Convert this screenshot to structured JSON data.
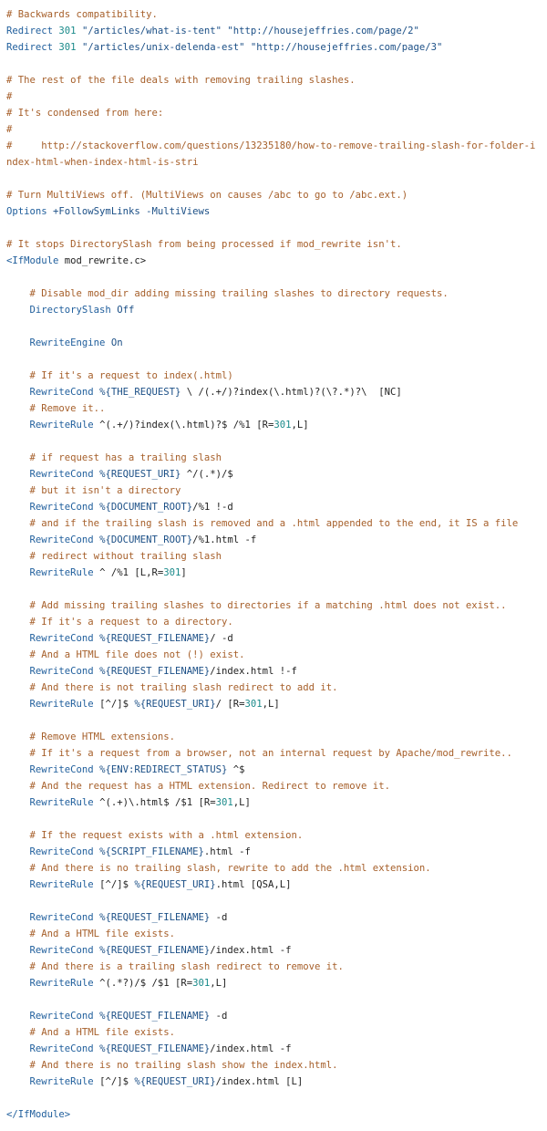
{
  "colors": {
    "comment": "#a65f2a",
    "directive": "#1f5e9c",
    "number": "#1a8a8a",
    "string": "#1b4f86",
    "plain": "#222222",
    "background": "#ffffff"
  },
  "lines": [
    {
      "type": "comment",
      "tokens": [
        {
          "t": "# Backwards compatibility.",
          "k": "comment"
        }
      ]
    },
    {
      "type": "code",
      "tokens": [
        {
          "t": "Redirect",
          "k": "directive"
        },
        {
          "t": " ",
          "k": "plain"
        },
        {
          "t": "301",
          "k": "num"
        },
        {
          "t": " \"/articles/what-is-tent\" \"http://housejeffries.com/page/2\"",
          "k": "str"
        }
      ]
    },
    {
      "type": "code",
      "tokens": [
        {
          "t": "Redirect",
          "k": "directive"
        },
        {
          "t": " ",
          "k": "plain"
        },
        {
          "t": "301",
          "k": "num"
        },
        {
          "t": " \"/articles/unix-delenda-est\" \"http://housejeffries.com/page/3\"",
          "k": "str"
        }
      ]
    },
    {
      "type": "blank",
      "tokens": []
    },
    {
      "type": "comment",
      "tokens": [
        {
          "t": "# The rest of the file deals with removing trailing slashes.",
          "k": "comment"
        }
      ]
    },
    {
      "type": "comment",
      "tokens": [
        {
          "t": "#",
          "k": "comment"
        }
      ]
    },
    {
      "type": "comment",
      "tokens": [
        {
          "t": "# It's condensed from here:",
          "k": "comment"
        }
      ]
    },
    {
      "type": "comment",
      "tokens": [
        {
          "t": "#",
          "k": "comment"
        }
      ]
    },
    {
      "type": "comment-wrap",
      "tokens": [
        {
          "t": "#     http://stackoverflow.com/questions/13235180/how-to-remove-trailing-slash-for-folder-index-html-when-index-html-is-stri",
          "k": "comment"
        }
      ]
    },
    {
      "type": "blank",
      "tokens": []
    },
    {
      "type": "comment",
      "tokens": [
        {
          "t": "# Turn MultiViews off. (MultiViews on causes /abc to go to /abc.ext.)",
          "k": "comment"
        }
      ]
    },
    {
      "type": "code",
      "tokens": [
        {
          "t": "Options",
          "k": "directive"
        },
        {
          "t": " +FollowSymLinks -MultiViews",
          "k": "str"
        }
      ]
    },
    {
      "type": "blank",
      "tokens": []
    },
    {
      "type": "comment",
      "tokens": [
        {
          "t": "# It stops DirectorySlash from being processed if mod_rewrite isn't.",
          "k": "comment"
        }
      ]
    },
    {
      "type": "code",
      "tokens": [
        {
          "t": "<IfModule",
          "k": "directive"
        },
        {
          "t": " mod_rewrite.c>",
          "k": "plain"
        }
      ]
    },
    {
      "type": "blank",
      "tokens": []
    },
    {
      "type": "comment",
      "tokens": [
        {
          "t": "    # Disable mod_dir adding missing trailing slashes to directory requests.",
          "k": "comment"
        }
      ]
    },
    {
      "type": "code",
      "tokens": [
        {
          "t": "    ",
          "k": "plain"
        },
        {
          "t": "DirectorySlash",
          "k": "directive"
        },
        {
          "t": " Off",
          "k": "str"
        }
      ]
    },
    {
      "type": "blank",
      "tokens": []
    },
    {
      "type": "code",
      "tokens": [
        {
          "t": "    ",
          "k": "plain"
        },
        {
          "t": "RewriteEngine",
          "k": "directive"
        },
        {
          "t": " On",
          "k": "str"
        }
      ]
    },
    {
      "type": "blank",
      "tokens": []
    },
    {
      "type": "comment",
      "tokens": [
        {
          "t": "    # If it's a request to index(.html)",
          "k": "comment"
        }
      ]
    },
    {
      "type": "code",
      "tokens": [
        {
          "t": "    ",
          "k": "plain"
        },
        {
          "t": "RewriteCond",
          "k": "directive"
        },
        {
          "t": " %{THE_REQUEST}",
          "k": "str"
        },
        {
          "t": " \\ /(.+/)?index(\\.html)?(\\?.*)?\\  [NC]",
          "k": "plain"
        }
      ]
    },
    {
      "type": "comment",
      "tokens": [
        {
          "t": "    # Remove it..",
          "k": "comment"
        }
      ]
    },
    {
      "type": "code",
      "tokens": [
        {
          "t": "    ",
          "k": "plain"
        },
        {
          "t": "RewriteRule",
          "k": "directive"
        },
        {
          "t": " ^(.+/)?index(\\.html)?$ /%1 [R=",
          "k": "plain"
        },
        {
          "t": "301",
          "k": "num"
        },
        {
          "t": ",L]",
          "k": "plain"
        }
      ]
    },
    {
      "type": "blank",
      "tokens": []
    },
    {
      "type": "comment",
      "tokens": [
        {
          "t": "    # if request has a trailing slash",
          "k": "comment"
        }
      ]
    },
    {
      "type": "code",
      "tokens": [
        {
          "t": "    ",
          "k": "plain"
        },
        {
          "t": "RewriteCond",
          "k": "directive"
        },
        {
          "t": " %{REQUEST_URI}",
          "k": "str"
        },
        {
          "t": " ^/(.*)/$",
          "k": "plain"
        }
      ]
    },
    {
      "type": "comment",
      "tokens": [
        {
          "t": "    # but it isn't a directory",
          "k": "comment"
        }
      ]
    },
    {
      "type": "code",
      "tokens": [
        {
          "t": "    ",
          "k": "plain"
        },
        {
          "t": "RewriteCond",
          "k": "directive"
        },
        {
          "t": " %{DOCUMENT_ROOT}",
          "k": "str"
        },
        {
          "t": "/%1 !-d",
          "k": "plain"
        }
      ]
    },
    {
      "type": "comment",
      "tokens": [
        {
          "t": "    # and if the trailing slash is removed and a .html appended to the end, it IS a file",
          "k": "comment"
        }
      ]
    },
    {
      "type": "code",
      "tokens": [
        {
          "t": "    ",
          "k": "plain"
        },
        {
          "t": "RewriteCond",
          "k": "directive"
        },
        {
          "t": " %{DOCUMENT_ROOT}",
          "k": "str"
        },
        {
          "t": "/%1.html -f",
          "k": "plain"
        }
      ]
    },
    {
      "type": "comment",
      "tokens": [
        {
          "t": "    # redirect without trailing slash",
          "k": "comment"
        }
      ]
    },
    {
      "type": "code",
      "tokens": [
        {
          "t": "    ",
          "k": "plain"
        },
        {
          "t": "RewriteRule",
          "k": "directive"
        },
        {
          "t": " ^ /%1 [L,R=",
          "k": "plain"
        },
        {
          "t": "301",
          "k": "num"
        },
        {
          "t": "]",
          "k": "plain"
        }
      ]
    },
    {
      "type": "blank",
      "tokens": []
    },
    {
      "type": "comment",
      "tokens": [
        {
          "t": "    # Add missing trailing slashes to directories if a matching .html does not exist..",
          "k": "comment"
        }
      ]
    },
    {
      "type": "comment",
      "tokens": [
        {
          "t": "    # If it's a request to a directory.",
          "k": "comment"
        }
      ]
    },
    {
      "type": "code",
      "tokens": [
        {
          "t": "    ",
          "k": "plain"
        },
        {
          "t": "RewriteCond",
          "k": "directive"
        },
        {
          "t": " %{REQUEST_FILENAME}",
          "k": "str"
        },
        {
          "t": "/ -d",
          "k": "plain"
        }
      ]
    },
    {
      "type": "comment",
      "tokens": [
        {
          "t": "    # And a HTML file does not (!) exist.",
          "k": "comment"
        }
      ]
    },
    {
      "type": "code",
      "tokens": [
        {
          "t": "    ",
          "k": "plain"
        },
        {
          "t": "RewriteCond",
          "k": "directive"
        },
        {
          "t": " %{REQUEST_FILENAME}",
          "k": "str"
        },
        {
          "t": "/index.html !-f",
          "k": "plain"
        }
      ]
    },
    {
      "type": "comment",
      "tokens": [
        {
          "t": "    # And there is not trailing slash redirect to add it.",
          "k": "comment"
        }
      ]
    },
    {
      "type": "code",
      "tokens": [
        {
          "t": "    ",
          "k": "plain"
        },
        {
          "t": "RewriteRule",
          "k": "directive"
        },
        {
          "t": " [^/]$ ",
          "k": "plain"
        },
        {
          "t": "%{REQUEST_URI}",
          "k": "str"
        },
        {
          "t": "/ [R=",
          "k": "plain"
        },
        {
          "t": "301",
          "k": "num"
        },
        {
          "t": ",L]",
          "k": "plain"
        }
      ]
    },
    {
      "type": "blank",
      "tokens": []
    },
    {
      "type": "comment",
      "tokens": [
        {
          "t": "    # Remove HTML extensions.",
          "k": "comment"
        }
      ]
    },
    {
      "type": "comment",
      "tokens": [
        {
          "t": "    # If it's a request from a browser, not an internal request by Apache/mod_rewrite..",
          "k": "comment"
        }
      ]
    },
    {
      "type": "code",
      "tokens": [
        {
          "t": "    ",
          "k": "plain"
        },
        {
          "t": "RewriteCond",
          "k": "directive"
        },
        {
          "t": " %{ENV:REDIRECT_STATUS}",
          "k": "str"
        },
        {
          "t": " ^$",
          "k": "plain"
        }
      ]
    },
    {
      "type": "comment",
      "tokens": [
        {
          "t": "    # And the request has a HTML extension. Redirect to remove it.",
          "k": "comment"
        }
      ]
    },
    {
      "type": "code",
      "tokens": [
        {
          "t": "    ",
          "k": "plain"
        },
        {
          "t": "RewriteRule",
          "k": "directive"
        },
        {
          "t": " ^(.+)\\.html$ /$1 [R=",
          "k": "plain"
        },
        {
          "t": "301",
          "k": "num"
        },
        {
          "t": ",L]",
          "k": "plain"
        }
      ]
    },
    {
      "type": "blank",
      "tokens": []
    },
    {
      "type": "comment",
      "tokens": [
        {
          "t": "    # If the request exists with a .html extension.",
          "k": "comment"
        }
      ]
    },
    {
      "type": "code",
      "tokens": [
        {
          "t": "    ",
          "k": "plain"
        },
        {
          "t": "RewriteCond",
          "k": "directive"
        },
        {
          "t": " %{SCRIPT_FILENAME}",
          "k": "str"
        },
        {
          "t": ".html -f",
          "k": "plain"
        }
      ]
    },
    {
      "type": "comment",
      "tokens": [
        {
          "t": "    # And there is no trailing slash, rewrite to add the .html extension.",
          "k": "comment"
        }
      ]
    },
    {
      "type": "code",
      "tokens": [
        {
          "t": "    ",
          "k": "plain"
        },
        {
          "t": "RewriteRule",
          "k": "directive"
        },
        {
          "t": " [^/]$ ",
          "k": "plain"
        },
        {
          "t": "%{REQUEST_URI}",
          "k": "str"
        },
        {
          "t": ".html [QSA,L]",
          "k": "plain"
        }
      ]
    },
    {
      "type": "blank",
      "tokens": []
    },
    {
      "type": "code",
      "tokens": [
        {
          "t": "    ",
          "k": "plain"
        },
        {
          "t": "RewriteCond",
          "k": "directive"
        },
        {
          "t": " %{REQUEST_FILENAME}",
          "k": "str"
        },
        {
          "t": " -d",
          "k": "plain"
        }
      ]
    },
    {
      "type": "comment",
      "tokens": [
        {
          "t": "    # And a HTML file exists.",
          "k": "comment"
        }
      ]
    },
    {
      "type": "code",
      "tokens": [
        {
          "t": "    ",
          "k": "plain"
        },
        {
          "t": "RewriteCond",
          "k": "directive"
        },
        {
          "t": " %{REQUEST_FILENAME}",
          "k": "str"
        },
        {
          "t": "/index.html -f",
          "k": "plain"
        }
      ]
    },
    {
      "type": "comment",
      "tokens": [
        {
          "t": "    # And there is a trailing slash redirect to remove it.",
          "k": "comment"
        }
      ]
    },
    {
      "type": "code",
      "tokens": [
        {
          "t": "    ",
          "k": "plain"
        },
        {
          "t": "RewriteRule",
          "k": "directive"
        },
        {
          "t": " ^(.*?)/$ /$1 [R=",
          "k": "plain"
        },
        {
          "t": "301",
          "k": "num"
        },
        {
          "t": ",L]",
          "k": "plain"
        }
      ]
    },
    {
      "type": "blank",
      "tokens": []
    },
    {
      "type": "code",
      "tokens": [
        {
          "t": "    ",
          "k": "plain"
        },
        {
          "t": "RewriteCond",
          "k": "directive"
        },
        {
          "t": " %{REQUEST_FILENAME}",
          "k": "str"
        },
        {
          "t": " -d",
          "k": "plain"
        }
      ]
    },
    {
      "type": "comment",
      "tokens": [
        {
          "t": "    # And a HTML file exists.",
          "k": "comment"
        }
      ]
    },
    {
      "type": "code",
      "tokens": [
        {
          "t": "    ",
          "k": "plain"
        },
        {
          "t": "RewriteCond",
          "k": "directive"
        },
        {
          "t": " %{REQUEST_FILENAME}",
          "k": "str"
        },
        {
          "t": "/index.html -f",
          "k": "plain"
        }
      ]
    },
    {
      "type": "comment",
      "tokens": [
        {
          "t": "    # And there is no trailing slash show the index.html.",
          "k": "comment"
        }
      ]
    },
    {
      "type": "code",
      "tokens": [
        {
          "t": "    ",
          "k": "plain"
        },
        {
          "t": "RewriteRule",
          "k": "directive"
        },
        {
          "t": " [^/]$ ",
          "k": "plain"
        },
        {
          "t": "%{REQUEST_URI}",
          "k": "str"
        },
        {
          "t": "/index.html [L]",
          "k": "plain"
        }
      ]
    },
    {
      "type": "blank",
      "tokens": []
    },
    {
      "type": "code",
      "tokens": [
        {
          "t": "</IfModule>",
          "k": "directive"
        }
      ]
    }
  ]
}
